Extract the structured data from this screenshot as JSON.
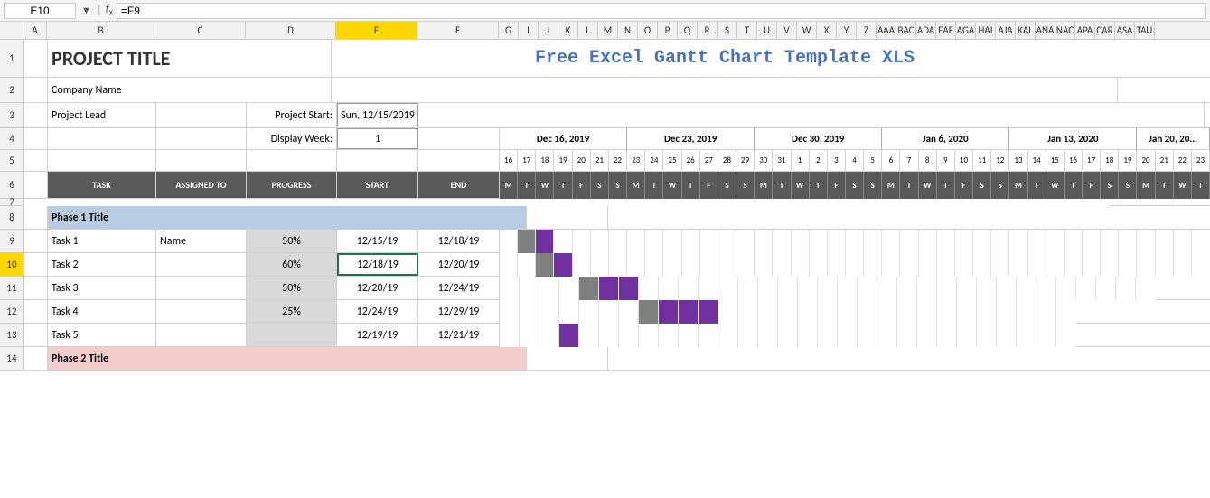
{
  "formula_bar": {
    "cell_ref": "E10",
    "formula": "=F9"
  },
  "header_title": "Free Excel Gantt Chart Template XLS",
  "project": {
    "title": "PROJECT TITLE",
    "company": "Company Name",
    "lead": "Project Lead",
    "start_label": "Project Start:",
    "start_value": "Sun, 12/15/2019",
    "week_label": "Display Week:",
    "week_value": "1"
  },
  "columns": {
    "headers": [
      "",
      "A",
      "B",
      "C",
      "D",
      "E",
      "F",
      "G",
      "I",
      "J",
      "K",
      "L",
      "M",
      "N",
      "O",
      "P",
      "Q",
      "R",
      "S",
      "T",
      "U",
      "V",
      "W",
      "X",
      "Y",
      "Z",
      "AAA",
      "BAC",
      "ADA",
      "EAF",
      "AGA",
      "HAI",
      "AJA",
      "KAL",
      "ANA",
      "NAC",
      "APA",
      "CAR",
      "ASA",
      "TAU"
    ]
  },
  "task_headers": {
    "task": "TASK",
    "assigned": "ASSIGNED TO",
    "progress": "PROGRESS",
    "start": "START",
    "end": "END"
  },
  "weeks": [
    {
      "label": "Dec 16, 2019",
      "days": [
        "16",
        "17",
        "18",
        "19",
        "20",
        "21",
        "22"
      ]
    },
    {
      "label": "Dec 23, 2019",
      "days": [
        "23",
        "24",
        "25",
        "26",
        "27",
        "28",
        "29"
      ]
    },
    {
      "label": "Dec 30, 2019",
      "days": [
        "30",
        "31",
        "1",
        "2",
        "3",
        "4",
        "5"
      ]
    },
    {
      "label": "Jan 6, 2020",
      "days": [
        "6",
        "7",
        "8",
        "9",
        "10",
        "11",
        "12"
      ]
    },
    {
      "label": "Jan 13, 2020",
      "days": [
        "13",
        "14",
        "15",
        "16",
        "17",
        "18",
        "19"
      ]
    },
    {
      "label": "Jan 20, 20...",
      "days": [
        "20",
        "21",
        "22",
        "23"
      ]
    }
  ],
  "day_labels": [
    "M",
    "T",
    "W",
    "T",
    "F",
    "S",
    "S",
    "M",
    "T",
    "W",
    "T",
    "F",
    "S",
    "S",
    "M",
    "T",
    "W",
    "T",
    "F",
    "S",
    "S",
    "M",
    "T",
    "W",
    "T",
    "F",
    "S",
    "S",
    "M",
    "T",
    "W",
    "T",
    "F",
    "S",
    "S",
    "M",
    "T",
    "W",
    "T"
  ],
  "tasks": [
    {
      "id": "phase1",
      "label": "Phase 1 Title",
      "type": "phase_blue"
    },
    {
      "id": "task1",
      "name": "Task 1",
      "assigned": "Name",
      "progress": "50%",
      "start": "12/15/19",
      "end": "12/18/19",
      "bars": [
        0,
        1,
        1,
        0,
        0,
        0,
        0,
        0,
        0,
        0,
        0,
        0,
        0,
        0,
        0,
        0,
        0,
        0,
        0,
        0,
        0,
        0,
        0,
        0,
        0,
        0,
        0,
        0,
        0,
        0,
        0,
        0,
        0,
        0,
        0,
        0,
        0,
        0,
        0
      ]
    },
    {
      "id": "task2",
      "name": "Task 2",
      "assigned": "",
      "progress": "60%",
      "start": "12/18/19",
      "end": "12/20/19",
      "bars": [
        0,
        0,
        0,
        2,
        2,
        0,
        0,
        0,
        0,
        0,
        0,
        0,
        0,
        0,
        0,
        0,
        0,
        0,
        0,
        0,
        0,
        0,
        0,
        0,
        0,
        0,
        0,
        0,
        0,
        0,
        0,
        0,
        0,
        0,
        0,
        0,
        0,
        0,
        0
      ]
    },
    {
      "id": "task3",
      "name": "Task 3",
      "assigned": "",
      "progress": "50%",
      "start": "12/20/19",
      "end": "12/24/19",
      "bars": [
        0,
        0,
        0,
        0,
        0,
        3,
        3,
        0,
        0,
        0,
        0,
        0,
        0,
        0,
        0,
        0,
        0,
        0,
        0,
        0,
        0,
        0,
        0,
        0,
        0,
        0,
        0,
        0,
        0,
        0,
        0,
        0,
        0,
        0,
        0,
        0,
        0,
        0,
        0
      ]
    },
    {
      "id": "task4",
      "name": "Task 4",
      "assigned": "",
      "progress": "25%",
      "start": "12/24/19",
      "end": "12/29/19",
      "bars": [
        0,
        0,
        0,
        0,
        0,
        0,
        0,
        0,
        4,
        4,
        4,
        0,
        0,
        0,
        0,
        0,
        0,
        0,
        0,
        0,
        0,
        0,
        0,
        0,
        0,
        0,
        0,
        0,
        0,
        0,
        0,
        0,
        0,
        0,
        0,
        0,
        0,
        0,
        0
      ]
    },
    {
      "id": "task5",
      "name": "Task 5",
      "assigned": "",
      "progress": "",
      "start": "12/19/19",
      "end": "12/21/19",
      "bars": [
        0,
        0,
        0,
        2,
        0,
        0,
        0,
        0,
        0,
        0,
        0,
        0,
        0,
        0,
        0,
        0,
        0,
        0,
        0,
        0,
        0,
        0,
        0,
        0,
        0,
        0,
        0,
        0,
        0,
        0,
        0,
        0,
        0,
        0,
        0,
        0,
        0,
        0,
        0
      ]
    },
    {
      "id": "phase2",
      "label": "Phase 2 Title",
      "type": "phase_pink"
    }
  ]
}
